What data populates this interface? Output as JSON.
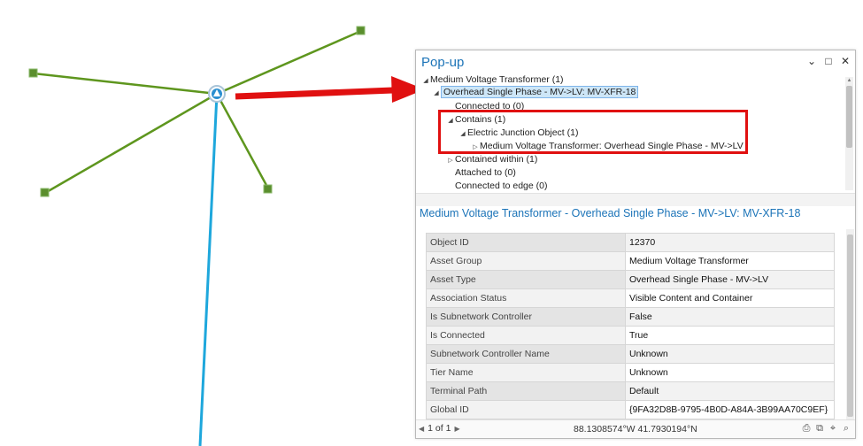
{
  "popup": {
    "title": "Pop-up",
    "controls": [
      {
        "icon": "chevron-down-icon",
        "glyph": "⌄"
      },
      {
        "icon": "maximize-icon",
        "glyph": "□"
      },
      {
        "icon": "close-icon",
        "glyph": "✕"
      }
    ],
    "tree": [
      {
        "tri": "◢",
        "label": "Medium Voltage Transformer (1)"
      },
      {
        "tri": "◢",
        "label": "Overhead Single Phase - MV->LV: MV-XFR-18"
      },
      {
        "tri": "",
        "label": "Connected to (0)"
      },
      {
        "tri": "◢",
        "label": "Contains (1)"
      },
      {
        "tri": "◢",
        "label": "Electric Junction Object (1)"
      },
      {
        "tri": "▷",
        "label": "Medium Voltage Transformer: Overhead Single Phase - MV->LV"
      },
      {
        "tri": "▷",
        "label": "Contained within (1)"
      },
      {
        "tri": "",
        "label": "Attached to (0)"
      },
      {
        "tri": "",
        "label": "Connected to edge (0)"
      }
    ],
    "detail_title": "Medium Voltage Transformer - Overhead Single Phase - MV->LV: MV-XFR-18",
    "attributes": [
      {
        "k": "Object ID",
        "v": "12370"
      },
      {
        "k": "Asset Group",
        "v": "Medium Voltage Transformer"
      },
      {
        "k": "Asset Type",
        "v": "Overhead Single Phase - MV->LV"
      },
      {
        "k": "Association Status",
        "v": "Visible Content and Container"
      },
      {
        "k": "Is Subnetwork Controller",
        "v": "False"
      },
      {
        "k": "Is Connected",
        "v": "True"
      },
      {
        "k": "Subnetwork Controller Name",
        "v": "Unknown"
      },
      {
        "k": "Tier Name",
        "v": "Unknown"
      },
      {
        "k": "Terminal Path",
        "v": "Default"
      },
      {
        "k": "Global ID",
        "v": "{9FA32D8B-9795-4B0D-A84A-3B99AA70C9EF}"
      }
    ],
    "footer": {
      "page": "1 of 1",
      "coords": "88.1308574°W 41.7930194°N",
      "icons": [
        {
          "icon": "print-icon",
          "glyph": "⎙"
        },
        {
          "icon": "expand-icon",
          "glyph": "⧉"
        },
        {
          "icon": "crosshair-icon",
          "glyph": "⌖"
        },
        {
          "icon": "zoom-icon",
          "glyph": "⌕"
        }
      ]
    }
  },
  "colors": {
    "line_green": "#5e961e",
    "line_blue": "#1ea7dc",
    "node_green": "#5a8e2d",
    "arrow_red": "#e01010",
    "title_blue": "#1c74b8"
  }
}
